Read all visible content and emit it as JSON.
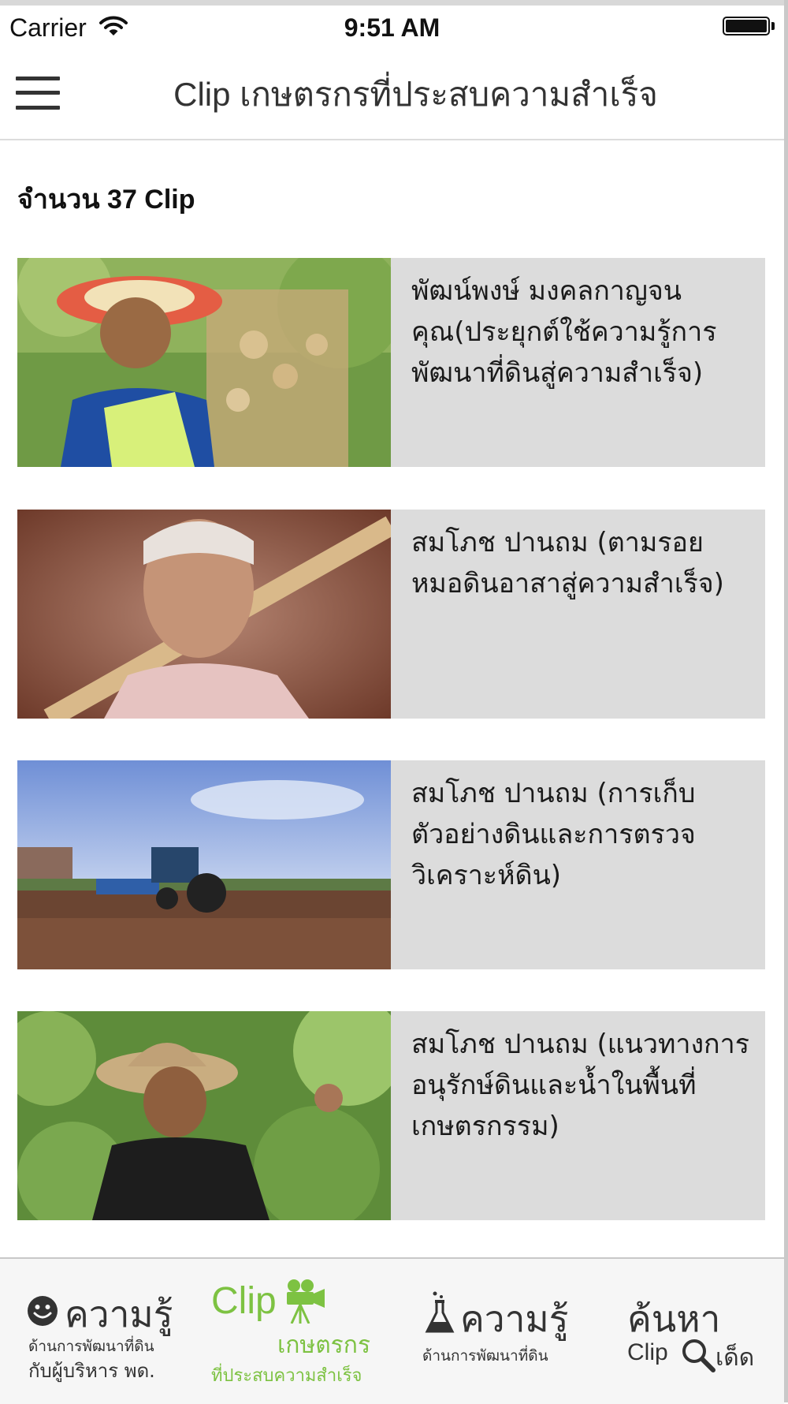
{
  "status_bar": {
    "carrier": "Carrier",
    "time": "9:51 AM"
  },
  "nav": {
    "title": "Clip เกษตรกรที่ประสบความสำเร็จ"
  },
  "count_text": "จำนวน 37 Clip",
  "clips": [
    {
      "title": "พัฒน์พงษ์ มงคลกาญจนคุณ(ประยุกต์ใช้ความรู้การพัฒนาที่ดินสู่ความสำเร็จ)",
      "thumbnail": "farmer-with-peanuts"
    },
    {
      "title": "สมโภช ปานถม (ตามรอยหมอดินอาสาสู่ความสำเร็จ)",
      "thumbnail": "elderly-farmer-with-hoe"
    },
    {
      "title": "สมโภช ปานถม (การเก็บตัวอย่างดินและการตรวจวิเคราะห์ดิน)",
      "thumbnail": "tractor-plowing-field"
    },
    {
      "title": "สมโภช ปานถม (แนวทางการอนุรักษ์ดินและน้ำในพื้นที่เกษตรกรรม)",
      "thumbnail": "farmer-in-bean-garden"
    }
  ],
  "tab_bar": {
    "active_color": "#7dc242",
    "text_color": "#333333",
    "tabs": [
      {
        "icon": "smiley-icon",
        "title": "ความรู้",
        "subtitle_1": "ด้านการพัฒนาที่ดิน",
        "subtitle_2": "กับผู้บริหาร พด."
      },
      {
        "icon": "video-camera-icon",
        "title": "Clip",
        "subtitle_1": "เกษตรกร",
        "subtitle_2": "ที่ประสบความสำเร็จ",
        "active": true
      },
      {
        "icon": "flask-icon",
        "title": "ความรู้",
        "subtitle_1": "ด้านการพัฒนาที่ดิน"
      },
      {
        "icon": "search-icon",
        "title": "ค้นหา",
        "subtitle_1": "Clip",
        "subtitle_2": "เด็ด"
      }
    ]
  }
}
